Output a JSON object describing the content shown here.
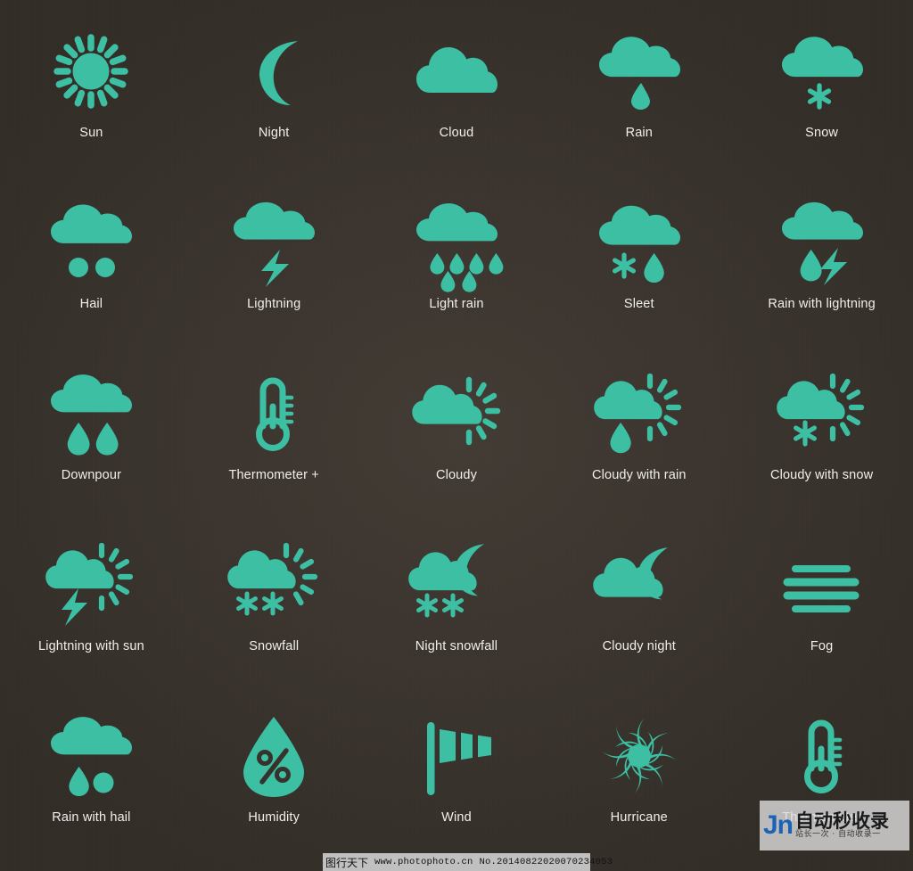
{
  "meta": {
    "palette": {
      "icon_teal": "#3dbfa4",
      "background_dark": "#3a342e",
      "label_text": "#f1efec"
    }
  },
  "icon_grid": {
    "columns": 5,
    "rows": 5,
    "items": [
      {
        "label": "Sun",
        "icon": "sun-icon"
      },
      {
        "label": "Night",
        "icon": "moon-icon"
      },
      {
        "label": "Cloud",
        "icon": "cloud-icon"
      },
      {
        "label": "Rain",
        "icon": "cloud-rain-icon"
      },
      {
        "label": "Snow",
        "icon": "cloud-snow-icon"
      },
      {
        "label": "Hail",
        "icon": "cloud-hail-icon"
      },
      {
        "label": "Lightning",
        "icon": "cloud-lightning-icon"
      },
      {
        "label": "Light rain",
        "icon": "cloud-light-rain-icon"
      },
      {
        "label": "Sleet",
        "icon": "cloud-sleet-icon"
      },
      {
        "label": "Rain with lightning",
        "icon": "cloud-rain-lightning-icon"
      },
      {
        "label": "Downpour",
        "icon": "cloud-downpour-icon"
      },
      {
        "label": "Thermometer +",
        "icon": "thermometer-plus-icon"
      },
      {
        "label": "Cloudy",
        "icon": "sun-cloud-icon"
      },
      {
        "label": "Cloudy with rain",
        "icon": "sun-cloud-rain-icon"
      },
      {
        "label": "Cloudy with snow",
        "icon": "sun-cloud-snow-icon"
      },
      {
        "label": "Lightning with sun",
        "icon": "sun-cloud-lightning-icon"
      },
      {
        "label": "Snowfall",
        "icon": "sun-cloud-snowfall-icon"
      },
      {
        "label": "Night snowfall",
        "icon": "moon-cloud-snowfall-icon"
      },
      {
        "label": "Cloudy night",
        "icon": "moon-cloud-icon"
      },
      {
        "label": "Fog",
        "icon": "fog-icon"
      },
      {
        "label": "Rain with hail",
        "icon": "cloud-rain-hail-icon"
      },
      {
        "label": "Humidity",
        "icon": "humidity-drop-percent-icon"
      },
      {
        "label": "Wind",
        "icon": "windsock-icon"
      },
      {
        "label": "Hurricane",
        "icon": "hurricane-spiral-icon"
      },
      {
        "label": "Thermometer",
        "icon": "thermometer-icon"
      }
    ]
  },
  "watermarks": {
    "center": {
      "logo_text": "Jn",
      "chinese_main": "自动秒收录",
      "chinese_sub": "站长一次 · 自动收录一"
    },
    "bottom": {
      "site_cjk": "图行天下",
      "site_url": "www.photophoto.cn",
      "photo_id": "No.20140822020070234053"
    }
  }
}
